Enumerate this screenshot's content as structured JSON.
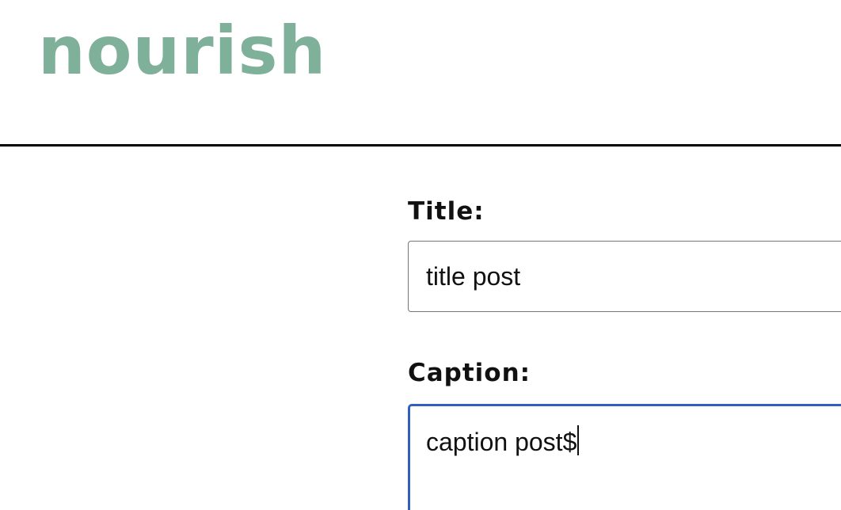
{
  "app": {
    "logo_text": "nourish",
    "brand_color": "#7eb09a"
  },
  "form": {
    "title": {
      "label": "Title:",
      "value": "title post"
    },
    "caption": {
      "label": "Caption:",
      "value": "caption post$",
      "focused": true,
      "focus_color": "#2f5fbf"
    }
  }
}
